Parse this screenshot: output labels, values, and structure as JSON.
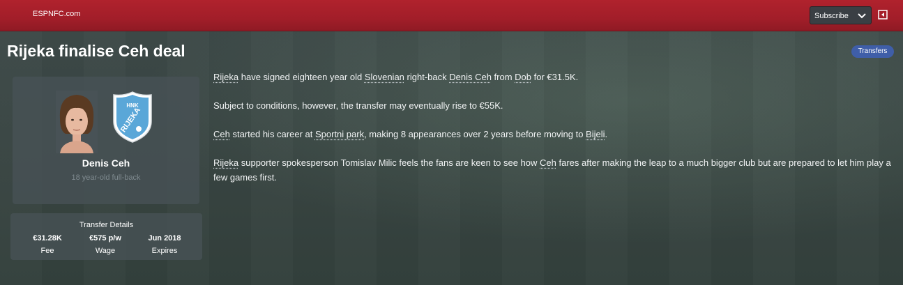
{
  "header": {
    "brand": "ESPNFC.com",
    "subscribe_label": "Subscribe"
  },
  "article": {
    "headline": "Rijeka finalise Ceh deal",
    "tag": "Transfers",
    "p1": {
      "club": "Rijeka",
      "t1": " have signed eighteen year old ",
      "nationality": "Slovenian",
      "t2": " right-back ",
      "player": "Denis Ceh",
      "t3": " from ",
      "from_club": "Dob",
      "t4": " for €31.5K."
    },
    "p2": "Subject to conditions, however, the transfer may eventually rise to €55K.",
    "p3": {
      "player": "Ceh",
      "t1": " started his career at ",
      "first_club": "Sportni park",
      "t2": ", making 8 appearances over 2 years before moving to ",
      "next_club": "Bijeli",
      "t3": "."
    },
    "p4": {
      "club": "Rijeka",
      "t1": " supporter spokesperson Tomislav Milic feels the fans are keen to see how ",
      "player": "Ceh",
      "t2": " fares after making the leap to a much bigger club but are prepared to let him play a few games first."
    }
  },
  "player_card": {
    "name": "Denis Ceh",
    "description": "18 year-old full-back",
    "crest_text": "RIJEKA",
    "crest_top": "HNK"
  },
  "transfer_details": {
    "title": "Transfer Details",
    "fee_value": "€31.28K",
    "fee_label": "Fee",
    "wage_value": "€575 p/w",
    "wage_label": "Wage",
    "expires_value": "Jun 2018",
    "expires_label": "Expires"
  },
  "colors": {
    "topbar": "#a21e29",
    "tag": "#3f5ea8",
    "crest_blue": "#5aa7d8"
  },
  "icons": [
    "chevron-down-icon",
    "exit-icon",
    "player-photo",
    "club-crest"
  ]
}
